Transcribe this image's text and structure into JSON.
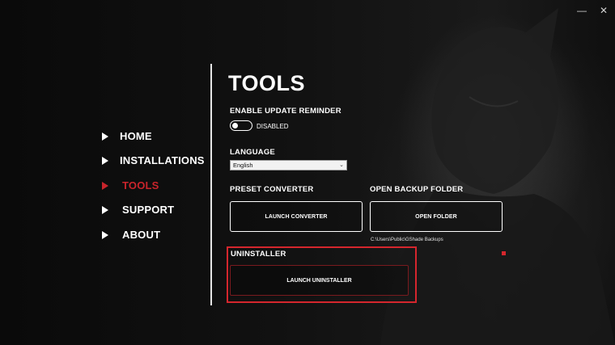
{
  "window": {
    "minimize_glyph": "—",
    "close_glyph": "✕"
  },
  "nav": {
    "items": [
      {
        "label": "HOME",
        "active": false
      },
      {
        "label": "INSTALLATIONS",
        "active": false
      },
      {
        "label": "TOOLS",
        "active": true
      },
      {
        "label": "SUPPORT",
        "active": false
      },
      {
        "label": "ABOUT",
        "active": false
      }
    ]
  },
  "page": {
    "title": "TOOLS"
  },
  "update_reminder": {
    "label": "ENABLE UPDATE REMINDER",
    "state_label": "DISABLED",
    "enabled": false
  },
  "language": {
    "label": "LANGUAGE",
    "selected": "English"
  },
  "preset_converter": {
    "label": "PRESET CONVERTER",
    "button": "LAUNCH CONVERTER"
  },
  "backup_folder": {
    "label": "OPEN BACKUP FOLDER",
    "button": "OPEN FOLDER",
    "path": "C:\\Users\\Public\\GShade Backups"
  },
  "uninstaller": {
    "label": "UNINSTALLER",
    "button": "LAUNCH UNINSTALLER"
  },
  "colors": {
    "accent": "#c8242b",
    "highlight": "#d5262d",
    "background": "#0b0b0b"
  },
  "icons": {
    "nav_arrow": "play-triangle-icon",
    "select_arrow": "chevron-down-icon"
  }
}
